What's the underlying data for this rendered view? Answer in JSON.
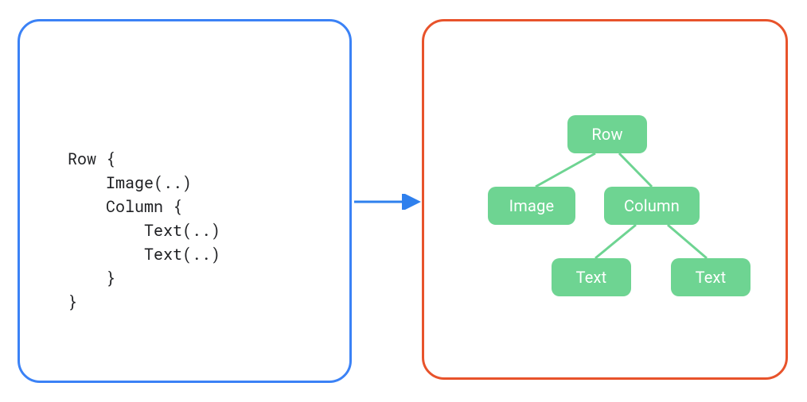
{
  "code": {
    "lines": [
      "Row {",
      "    Image(..)",
      "    Column {",
      "        Text(..)",
      "        Text(..)",
      "    }",
      "}"
    ]
  },
  "tree": {
    "root": "Row",
    "childA": "Image",
    "childB": "Column",
    "leafA": "Text",
    "leafB": "Text"
  },
  "colors": {
    "panel_left_border": "#3b82f6",
    "panel_right_border": "#e8532b",
    "arrow": "#2f80ed",
    "node_fill": "#6ed492",
    "edge": "#6ed492",
    "node_text": "#ffffff",
    "code_text": "#202124"
  }
}
